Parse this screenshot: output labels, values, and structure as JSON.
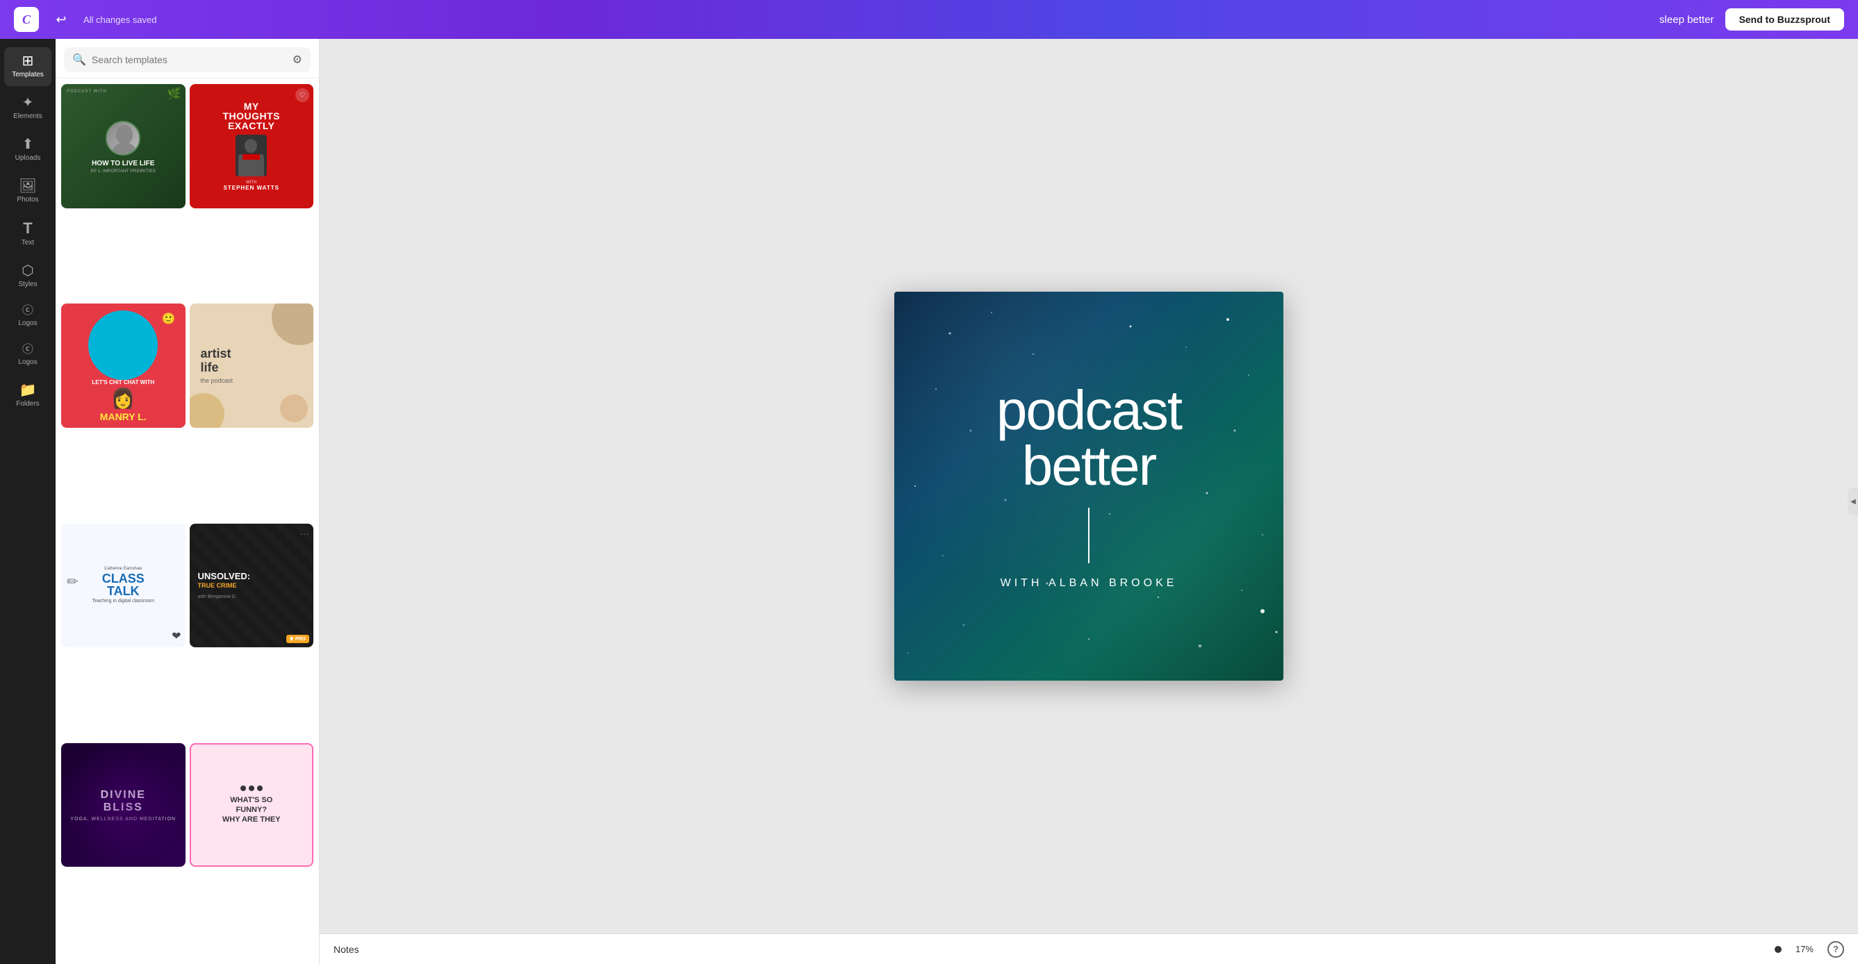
{
  "header": {
    "logo_text": "C",
    "saved_status": "All changes saved",
    "project_name": "sleep better",
    "send_button_label": "Send to Buzzsprout"
  },
  "sidebar": {
    "items": [
      {
        "id": "templates",
        "label": "Templates",
        "icon": "⊞",
        "active": true
      },
      {
        "id": "elements",
        "label": "Elements",
        "icon": "✦"
      },
      {
        "id": "uploads",
        "label": "Uploads",
        "icon": "↑"
      },
      {
        "id": "photos",
        "label": "Photos",
        "icon": "🖼"
      },
      {
        "id": "text",
        "label": "Text",
        "icon": "T"
      },
      {
        "id": "styles",
        "label": "Styles",
        "icon": "⬡"
      },
      {
        "id": "logos",
        "label": "Logos",
        "icon": "©"
      },
      {
        "id": "logos2",
        "label": "Logos",
        "icon": "©"
      },
      {
        "id": "folders",
        "label": "Folders",
        "icon": "📁"
      }
    ]
  },
  "templates_panel": {
    "search_placeholder": "Search templates",
    "search_value": "",
    "templates": [
      {
        "id": "how-to-live",
        "title": "HOW TO LIVE LIFE",
        "subtitle": "EP 1: IMPORTANT PRIORITIES",
        "badge": "PODCAST WITH"
      },
      {
        "id": "my-thoughts",
        "title": "MY THOUGHTS EXACTLY",
        "with": "WITH",
        "author": "STEPHEN WATTS"
      },
      {
        "id": "manry",
        "name": "MANRY L.",
        "chat": "LET'S CHIT CHAT WITH"
      },
      {
        "id": "artist-life",
        "title": "artist life",
        "subtitle": "the podcast"
      },
      {
        "id": "class-talk",
        "title": "CLASS TALK",
        "subtitle": "Teaching in digital classroom"
      },
      {
        "id": "unsolved",
        "title": "UNSOLVED:",
        "crime": "TRUE CRIME",
        "host": "with Benjamine D.",
        "pro": true
      },
      {
        "id": "divine",
        "title": "DIVINE BLISS",
        "subtitle": "YOGA, WELLNESS AND MEDITATION"
      },
      {
        "id": "funny",
        "title": "WHAT'S SO FUNNY? WHY ARE THEY"
      }
    ]
  },
  "canvas": {
    "title_line1": "podcast",
    "title_line2": "better",
    "subtitle": "WITH ALBAN BROOKE"
  },
  "notes_bar": {
    "label": "Notes",
    "zoom": "17%",
    "help_label": "?"
  }
}
